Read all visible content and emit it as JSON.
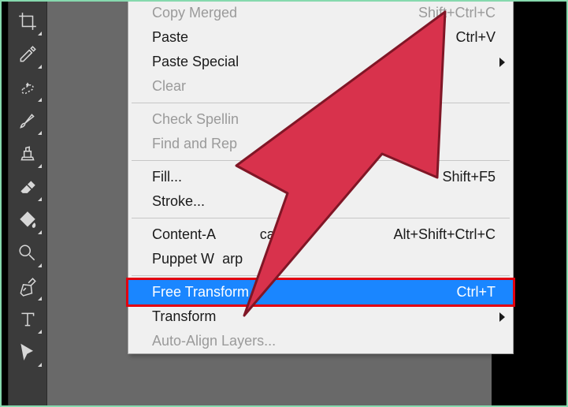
{
  "toolbar": {
    "tools": [
      {
        "name": "crop-tool"
      },
      {
        "name": "eyedropper-tool"
      },
      {
        "name": "healing-brush-tool"
      },
      {
        "name": "brush-tool"
      },
      {
        "name": "clone-stamp-tool"
      },
      {
        "name": "eraser-tool"
      },
      {
        "name": "paint-bucket-tool"
      },
      {
        "name": "dodge-tool"
      },
      {
        "name": "pen-tool"
      },
      {
        "name": "type-tool"
      },
      {
        "name": "path-selection-tool"
      }
    ]
  },
  "menu": {
    "items": [
      {
        "label": "Copy Merged",
        "shortcut": "Shift+Ctrl+C",
        "disabled": true
      },
      {
        "label": "Paste",
        "shortcut": "Ctrl+V"
      },
      {
        "label": "Paste Special",
        "submenu": true
      },
      {
        "label": "Clear",
        "disabled": true
      },
      {
        "sep": true
      },
      {
        "label": "Check Spelling...",
        "disabled": true,
        "truncated": "Check Spellin"
      },
      {
        "label": "Find and Replace Text...",
        "disabled": true,
        "truncated": "Find and Rep"
      },
      {
        "sep": true
      },
      {
        "label": "Fill...",
        "shortcut": "Shift+F5"
      },
      {
        "label": "Stroke..."
      },
      {
        "sep": true
      },
      {
        "label": "Content-Aware Scale",
        "shortcut": "Alt+Shift+Ctrl+C",
        "truncated_left": "Content-A",
        "truncated_right": "cale"
      },
      {
        "label": "Puppet Warp",
        "truncated_left": "Puppet W",
        "truncated_right": "arp"
      },
      {
        "sep": true
      },
      {
        "label": "Free Transform",
        "shortcut": "Ctrl+T",
        "highlight": true
      },
      {
        "label": "Transform",
        "submenu": true
      },
      {
        "label": "Auto-Align Layers...",
        "disabled": true
      }
    ]
  },
  "overlay": {
    "arrow_color": "#d8324c",
    "arrow_stroke": "#801626"
  }
}
